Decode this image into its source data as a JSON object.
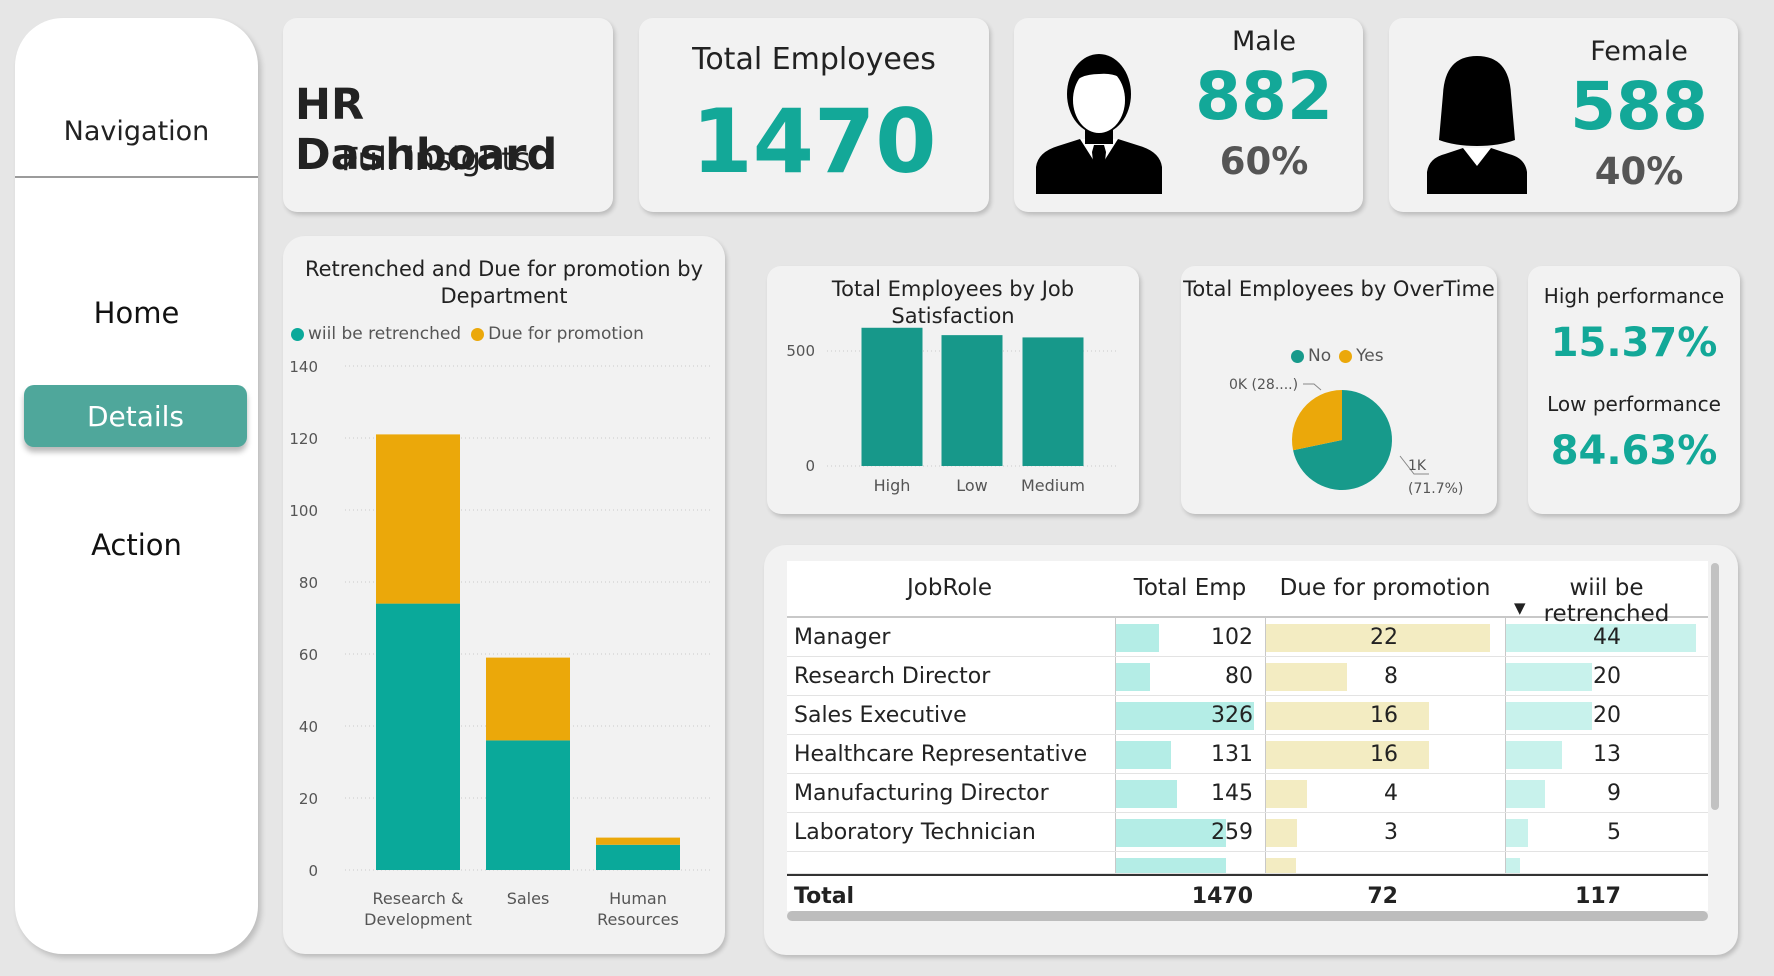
{
  "nav": {
    "title": "Navigation",
    "items": [
      {
        "label": "Home",
        "active": false
      },
      {
        "label": "Details",
        "active": true
      },
      {
        "label": "Action",
        "active": false
      }
    ]
  },
  "header": {
    "title": "HR Dashboard",
    "subtitle": "Full insights"
  },
  "kpis": {
    "total": {
      "label": "Total Employees",
      "value": "1470"
    },
    "male": {
      "label": "Male",
      "value": "882",
      "pct": "60%",
      "icon": "male-person-icon"
    },
    "female": {
      "label": "Female",
      "value": "588",
      "pct": "40%",
      "icon": "female-person-icon"
    },
    "performance": {
      "high_label": "High performance",
      "high_value": "15.37%",
      "low_label": "Low performance",
      "low_value": "84.63%"
    }
  },
  "colors": {
    "accent": "#13a898",
    "teal_bar": "#17988a",
    "amber": "#eba80a",
    "nav_active": "#4fa79b"
  },
  "chart_data": [
    {
      "type": "bar",
      "stacked": true,
      "title": "Retrenched and Due for promotion by Department",
      "categories": [
        "Research & Development",
        "Sales",
        "Human Resources"
      ],
      "category_lines": [
        [
          "Research &",
          "Development"
        ],
        [
          "Sales"
        ],
        [
          "Human",
          "Resources"
        ]
      ],
      "series": [
        {
          "name": "wiil be retrenched",
          "color": "#0aa99a",
          "values": [
            74,
            36,
            7
          ]
        },
        {
          "name": "Due for promotion",
          "color": "#eba80a",
          "values": [
            47,
            23,
            2
          ]
        }
      ],
      "ylim": [
        0,
        140
      ],
      "yticks": [
        "0",
        "20",
        "40",
        "60",
        "80",
        "100",
        "120",
        "140"
      ],
      "legend": "top-left",
      "grid": true
    },
    {
      "type": "bar",
      "title": "Total Employees by Job Satisfaction",
      "categories": [
        "High",
        "Low",
        "Medium"
      ],
      "values": [
        601,
        569,
        559
      ],
      "ylim": [
        0,
        600
      ],
      "yticks": [
        "0",
        "500"
      ],
      "grid": true
    },
    {
      "type": "pie",
      "title": "Total Employees by OverTime",
      "slices": [
        {
          "label": "No",
          "value": 1054,
          "color": "#179a8b",
          "data_label": "1K",
          "data_label_pct": "(71.7%)"
        },
        {
          "label": "Yes",
          "value": 416,
          "color": "#eba80a",
          "data_label": "0K (28....)"
        }
      ],
      "legend": "top-center"
    }
  ],
  "table": {
    "headers": [
      "JobRole",
      "Total Emp",
      "Due for promotion",
      "wiil be retrenched"
    ],
    "sort_indicator": "▼",
    "rows": [
      {
        "role": "Manager",
        "total": 102,
        "promo": 22,
        "retr": 44
      },
      {
        "role": "Research Director",
        "total": 80,
        "promo": 8,
        "retr": 20
      },
      {
        "role": "Sales Executive",
        "total": 326,
        "promo": 16,
        "retr": 20
      },
      {
        "role": "Healthcare Representative",
        "total": 131,
        "promo": 16,
        "retr": 13
      },
      {
        "role": "Manufacturing Director",
        "total": 145,
        "promo": 4,
        "retr": 9
      },
      {
        "role": "Laboratory Technician",
        "total": 259,
        "promo": 3,
        "retr": 5
      }
    ],
    "totals": {
      "label": "Total",
      "total": "1470",
      "promo": "72",
      "retr": "117"
    }
  }
}
